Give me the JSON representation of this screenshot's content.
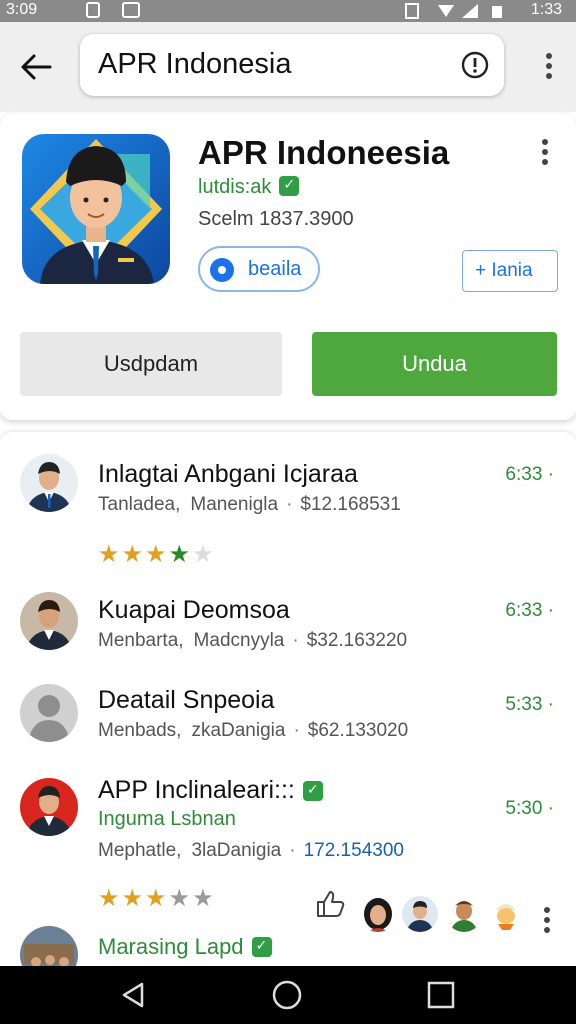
{
  "status_bar": {
    "time_left": "3:09",
    "time_right": "1:33"
  },
  "search": {
    "query": "APR Indonesia"
  },
  "app": {
    "title": "APR Indoneesia",
    "developer": "lutdis:ak",
    "score_label": "Scelm 1837.3900",
    "pill_label": "beaila",
    "add_label": "+ Iania",
    "secondary_button": "Usdpdam",
    "primary_button": "Undua",
    "accent_color": "#4ea83e"
  },
  "list": {
    "items": [
      {
        "title": "Inlagtai Anbgani Icjaraa",
        "sub_left": "Tanladea,",
        "sub_mid": "Manenigla",
        "price": "$12.168531",
        "time": "6:33",
        "rating": 3.5,
        "avatar": "man-in-suit"
      },
      {
        "title": "Kuapai Deomsoa",
        "sub_left": "Menbarta,",
        "sub_mid": "Madcnyyla",
        "price": "$32.163220",
        "time": "6:33",
        "avatar": "man-in-suit"
      },
      {
        "title": "Deatail Snpeoia",
        "sub_left": "Menbads,",
        "sub_mid": "zkaDanigia",
        "price": "$62.133020",
        "time": "5:33",
        "avatar": "placeholder-person"
      },
      {
        "title": "APP Inclinaleari:::",
        "subtitle": "Inguma Lsbnan",
        "sub_left": "Mephatle,",
        "sub_mid": "3laDanigia",
        "price": "172.154300",
        "time": "5:30",
        "rating": 2.5,
        "verified": true,
        "avatar": "man-red-background"
      },
      {
        "title": "Marasing Lapd",
        "verified": true,
        "avatar": "group-photo"
      }
    ]
  },
  "icons": [
    "back-arrow-icon",
    "info-icon",
    "more-vert-icon",
    "thumbs-up-icon",
    "nav-back-icon",
    "nav-home-icon",
    "nav-recents-icon"
  ]
}
